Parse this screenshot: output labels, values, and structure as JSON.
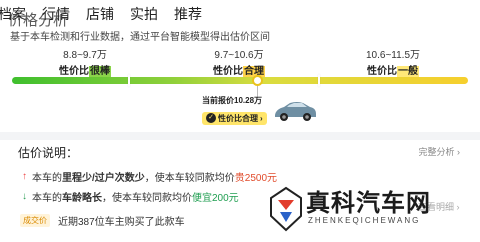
{
  "tabs": [
    "档案",
    "行情",
    "店铺",
    "实拍",
    "推荐"
  ],
  "overlap_title": "价格分析",
  "description": "基于本车检测和行业数据，通过平台智能模型得出估价区间",
  "ranges": [
    {
      "value": "8.8~9.7万",
      "label_prefix": "性价比",
      "label_highlight": "很棒"
    },
    {
      "value": "9.7~10.6万",
      "label_prefix": "性价比",
      "label_highlight": "合理"
    },
    {
      "value": "10.6~11.5万",
      "label_prefix": "性价比",
      "label_highlight": "一般"
    }
  ],
  "current_price": {
    "label": "当前报价10.28万",
    "badge": "性价比合理",
    "badge_icon": "ok",
    "arrow": "›"
  },
  "estimate": {
    "title": "估价说明：",
    "full_analysis": "完整分析 ›",
    "reasons": [
      {
        "direction": "up",
        "arrow": "↑",
        "text_before": "本车的",
        "text_bold": "里程少/过户次数少",
        "text_after": "，使本车较同款均价",
        "text_colored": "贵2500元"
      },
      {
        "direction": "down",
        "arrow": "↓",
        "text_before": "本车的",
        "text_bold": "车龄略长",
        "text_after": "，使本车较同款均价",
        "text_colored": "便宜200元"
      }
    ]
  },
  "deal": {
    "badge": "成交价",
    "text": "近期387位车主购买了此款车"
  },
  "watermark": {
    "main": "真科汽车网",
    "sub": "ZHENKEQICHEWANG",
    "behind": "查看明细 ›"
  },
  "colors": {
    "green_hl": "#8bd44a",
    "orange_hl": "#ffd34a",
    "yellow_hl": "#ffe878",
    "up_red": "#e14b2b",
    "down_green": "#1f9e50"
  }
}
